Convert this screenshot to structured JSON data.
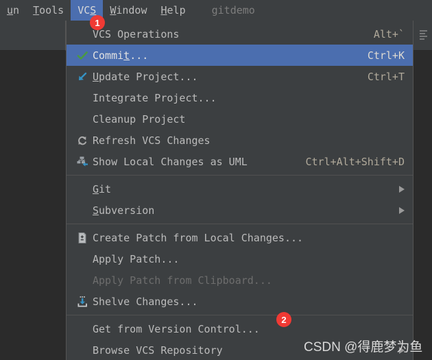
{
  "menubar": {
    "items": [
      {
        "label": "un",
        "mnemonic": "u",
        "active": false,
        "clipped": true
      },
      {
        "label": "Tools",
        "mnemonic": "T",
        "active": false,
        "clipped": false
      },
      {
        "label": "VCS",
        "mnemonic": "S",
        "active": true,
        "clipped": false
      },
      {
        "label": "Window",
        "mnemonic": "W",
        "active": false,
        "clipped": false
      },
      {
        "label": "Help",
        "mnemonic": "H",
        "active": false,
        "clipped": false
      }
    ],
    "project_name": "gitdemo"
  },
  "menu": {
    "name": "VCS",
    "items": [
      {
        "label": "VCS Operations",
        "accel": "Alt+`",
        "icon": "none",
        "selected": false,
        "disabled": false,
        "submenu": false,
        "mnemonic": ""
      },
      {
        "label": "Commit...",
        "accel": "Ctrl+K",
        "icon": "checkmark-icon",
        "selected": true,
        "disabled": false,
        "submenu": false,
        "mnemonic": "t"
      },
      {
        "label": "Update Project...",
        "accel": "Ctrl+T",
        "icon": "update-arrow-icon",
        "selected": false,
        "disabled": false,
        "submenu": false,
        "mnemonic": "U"
      },
      {
        "label": "Integrate Project...",
        "accel": "",
        "icon": "none",
        "selected": false,
        "disabled": false,
        "submenu": false,
        "mnemonic": "g"
      },
      {
        "label": "Cleanup Project",
        "accel": "",
        "icon": "none",
        "selected": false,
        "disabled": false,
        "submenu": false,
        "mnemonic": ""
      },
      {
        "label": "Refresh VCS Changes",
        "accel": "",
        "icon": "refresh-icon",
        "selected": false,
        "disabled": false,
        "submenu": false,
        "mnemonic": ""
      },
      {
        "label": "Show Local Changes as UML",
        "accel": "Ctrl+Alt+Shift+D",
        "icon": "uml-diagram-icon",
        "selected": false,
        "disabled": false,
        "submenu": false,
        "mnemonic": ""
      },
      {
        "separator": true
      },
      {
        "label": "Git",
        "accel": "",
        "icon": "none",
        "selected": false,
        "disabled": false,
        "submenu": true,
        "mnemonic": "G"
      },
      {
        "label": "Subversion",
        "accel": "",
        "icon": "none",
        "selected": false,
        "disabled": false,
        "submenu": true,
        "mnemonic": "S"
      },
      {
        "separator": true
      },
      {
        "label": "Create Patch from Local Changes...",
        "accel": "",
        "icon": "create-patch-icon",
        "selected": false,
        "disabled": false,
        "submenu": false,
        "mnemonic": ""
      },
      {
        "label": "Apply Patch...",
        "accel": "",
        "icon": "none",
        "selected": false,
        "disabled": false,
        "submenu": false,
        "mnemonic": ""
      },
      {
        "label": "Apply Patch from Clipboard...",
        "accel": "",
        "icon": "none",
        "selected": false,
        "disabled": true,
        "submenu": false,
        "mnemonic": ""
      },
      {
        "label": "Shelve Changes...",
        "accel": "",
        "icon": "shelve-icon",
        "selected": false,
        "disabled": false,
        "submenu": false,
        "mnemonic": ""
      },
      {
        "separator": true
      },
      {
        "label": "Get from Version Control...",
        "accel": "",
        "icon": "none",
        "selected": false,
        "disabled": false,
        "submenu": false,
        "mnemonic": ""
      },
      {
        "label": "Browse VCS Repository",
        "accel": "",
        "icon": "none",
        "selected": false,
        "disabled": false,
        "submenu": true,
        "mnemonic": ""
      }
    ]
  },
  "annotations": {
    "badges": [
      {
        "number": "1",
        "target": "VCS"
      },
      {
        "number": "2",
        "target": "Get from Version Control..."
      }
    ]
  },
  "watermark": {
    "text": "CSDN @得鹿梦为鱼"
  },
  "colors": {
    "menu_bg": "#3c3f41",
    "editor_bg": "#2b2b2b",
    "selection_blue": "#4b6eaf",
    "text": "#bbbbbb",
    "accel_text": "#b0a99a",
    "disabled_text": "#6d6d6d",
    "badge_red": "#f03a34",
    "separator": "#515151"
  }
}
